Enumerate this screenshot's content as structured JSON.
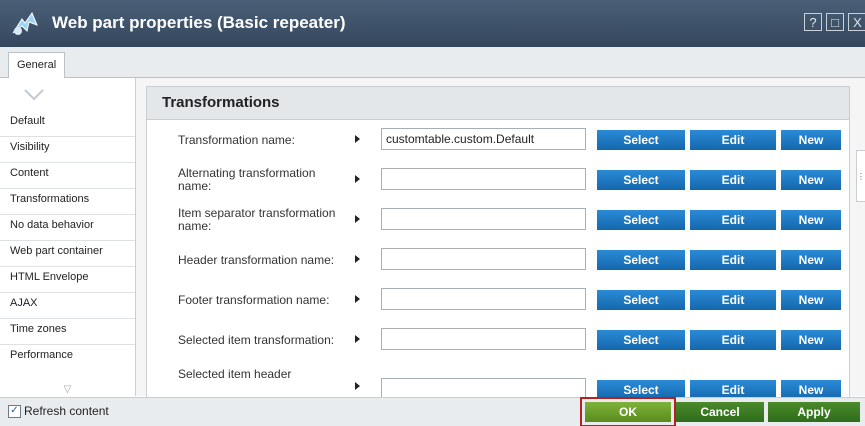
{
  "window": {
    "title": "Web part properties (Basic repeater)",
    "help_label": "?",
    "maximize_label": "□",
    "close_label": "X"
  },
  "tabs": [
    {
      "label": "General"
    }
  ],
  "sidebar": {
    "items": [
      {
        "label": "Default"
      },
      {
        "label": "Visibility"
      },
      {
        "label": "Content"
      },
      {
        "label": "Transformations"
      },
      {
        "label": "No data behavior"
      },
      {
        "label": "Web part container"
      },
      {
        "label": "HTML Envelope"
      },
      {
        "label": "AJAX"
      },
      {
        "label": "Time zones"
      },
      {
        "label": "Performance"
      }
    ]
  },
  "section": {
    "title": "Transformations"
  },
  "buttons": {
    "select": "Select",
    "edit": "Edit",
    "new": "New"
  },
  "rows": [
    {
      "label": "Transformation name:",
      "value": "customtable.custom.Default"
    },
    {
      "label": "Alternating transformation name:",
      "value": ""
    },
    {
      "label": "Item separator transformation name:",
      "value": ""
    },
    {
      "label": "Header transformation name:",
      "value": ""
    },
    {
      "label": "Footer transformation name:",
      "value": ""
    },
    {
      "label": "Selected item transformation:",
      "value": ""
    },
    {
      "label": "Selected item header",
      "value": ""
    }
  ],
  "footer": {
    "refresh_label": "Refresh content",
    "refresh_checked": true,
    "ok_label": "OK",
    "cancel_label": "Cancel",
    "apply_label": "Apply"
  },
  "colors": {
    "titlebar": "#3d5168",
    "action_blue": "#1a73c0",
    "ok_green": "#6aa22c",
    "highlight_red": "#b22222"
  }
}
